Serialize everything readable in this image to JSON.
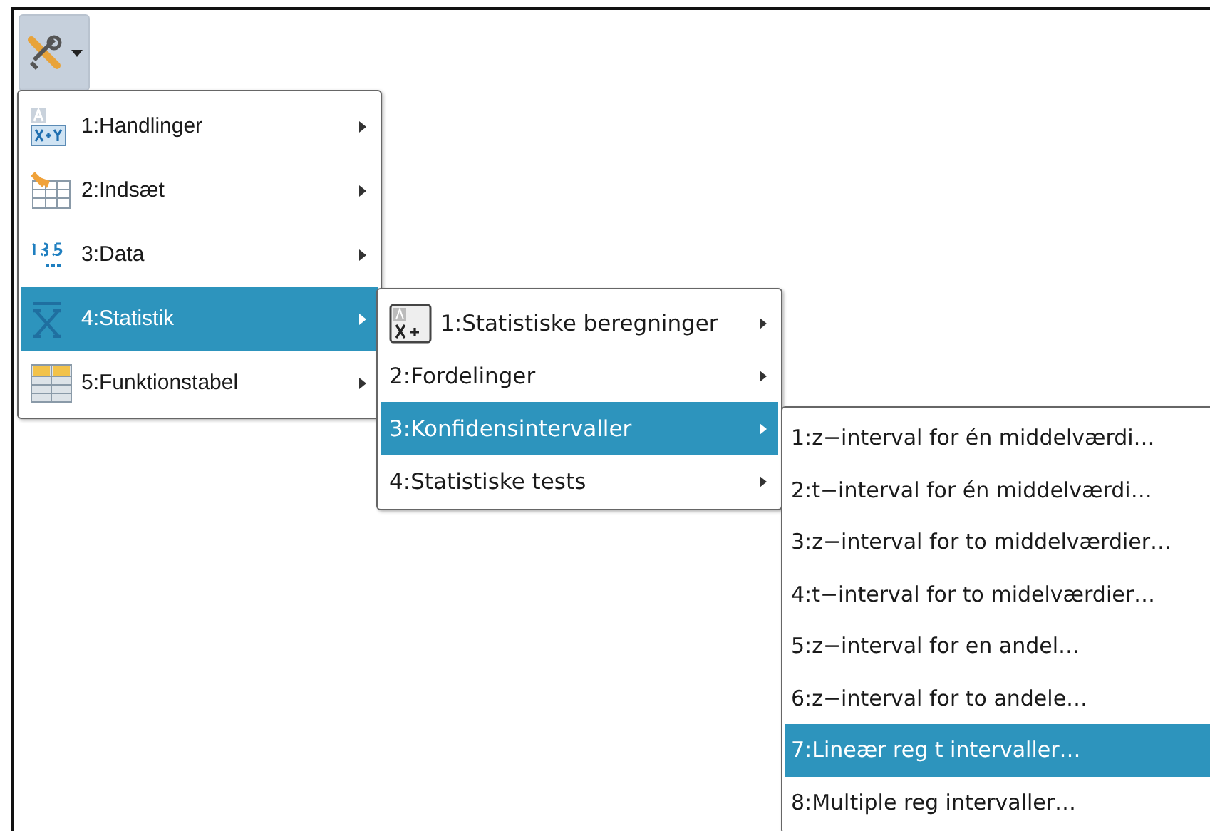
{
  "toolbar": {
    "button": {
      "expanded": true
    }
  },
  "menus": [
    {
      "items": [
        {
          "label": "1:Handlinger",
          "kind": "actions",
          "selected": false
        },
        {
          "label": "2:Indsæt",
          "kind": "insert",
          "selected": false
        },
        {
          "label": "3:Data",
          "kind": "data",
          "selected": false
        },
        {
          "label": "4:Statistik",
          "kind": "stats",
          "selected": true
        },
        {
          "label": "5:Funktionstabel",
          "kind": "table",
          "selected": false
        }
      ]
    },
    {
      "items": [
        {
          "label": "1:Statistiske beregninger",
          "kind": "calc",
          "selected": false
        },
        {
          "label": "2:Fordelinger",
          "selected": false
        },
        {
          "label": "3:Konfidensintervaller",
          "selected": true
        },
        {
          "label": "4:Statistiske tests",
          "selected": false
        }
      ]
    },
    {
      "items": [
        {
          "label": "1:z−interval for én middelværdi…",
          "selected": false
        },
        {
          "label": "2:t−interval for én middelværdi…",
          "selected": false
        },
        {
          "label": "3:z−interval for to middelværdier…",
          "selected": false
        },
        {
          "label": "4:t−interval for to midelværdier…",
          "selected": false
        },
        {
          "label": "5:z−interval for en andel…",
          "selected": false
        },
        {
          "label": "6:z−interval for to andele…",
          "selected": false
        },
        {
          "label": "7:Lineær reg t intervaller…",
          "selected": true
        },
        {
          "label": "8:Multiple reg intervaller…",
          "selected": false
        }
      ]
    }
  ]
}
